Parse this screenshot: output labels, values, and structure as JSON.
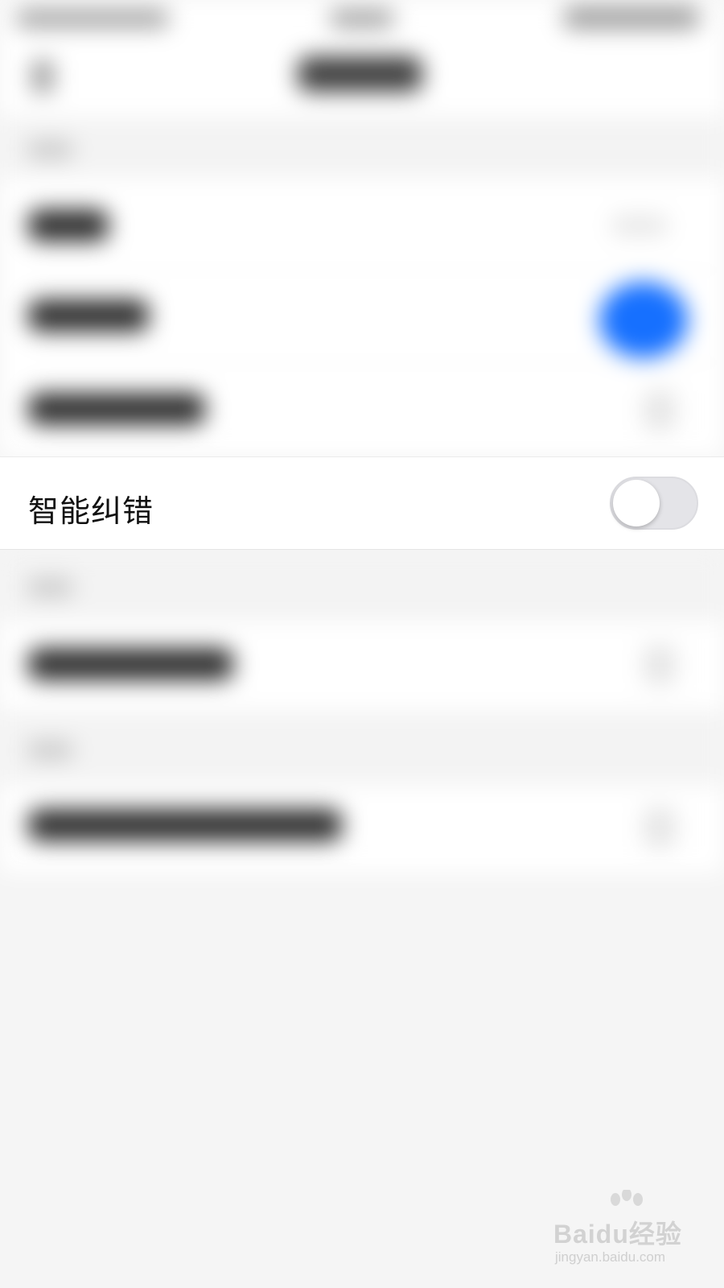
{
  "settings": {
    "smart_correction": {
      "label": "智能纠错",
      "enabled": false
    }
  },
  "watermark": {
    "brand": "Baidu经验",
    "url": "jingyan.baidu.com"
  },
  "colors": {
    "accent": "#1670ff",
    "toggle_off": "#e4e4e8",
    "background": "#f5f5f5"
  },
  "icons": {
    "back": "back-arrow-icon",
    "watermark": "baidu-paw-logo"
  }
}
